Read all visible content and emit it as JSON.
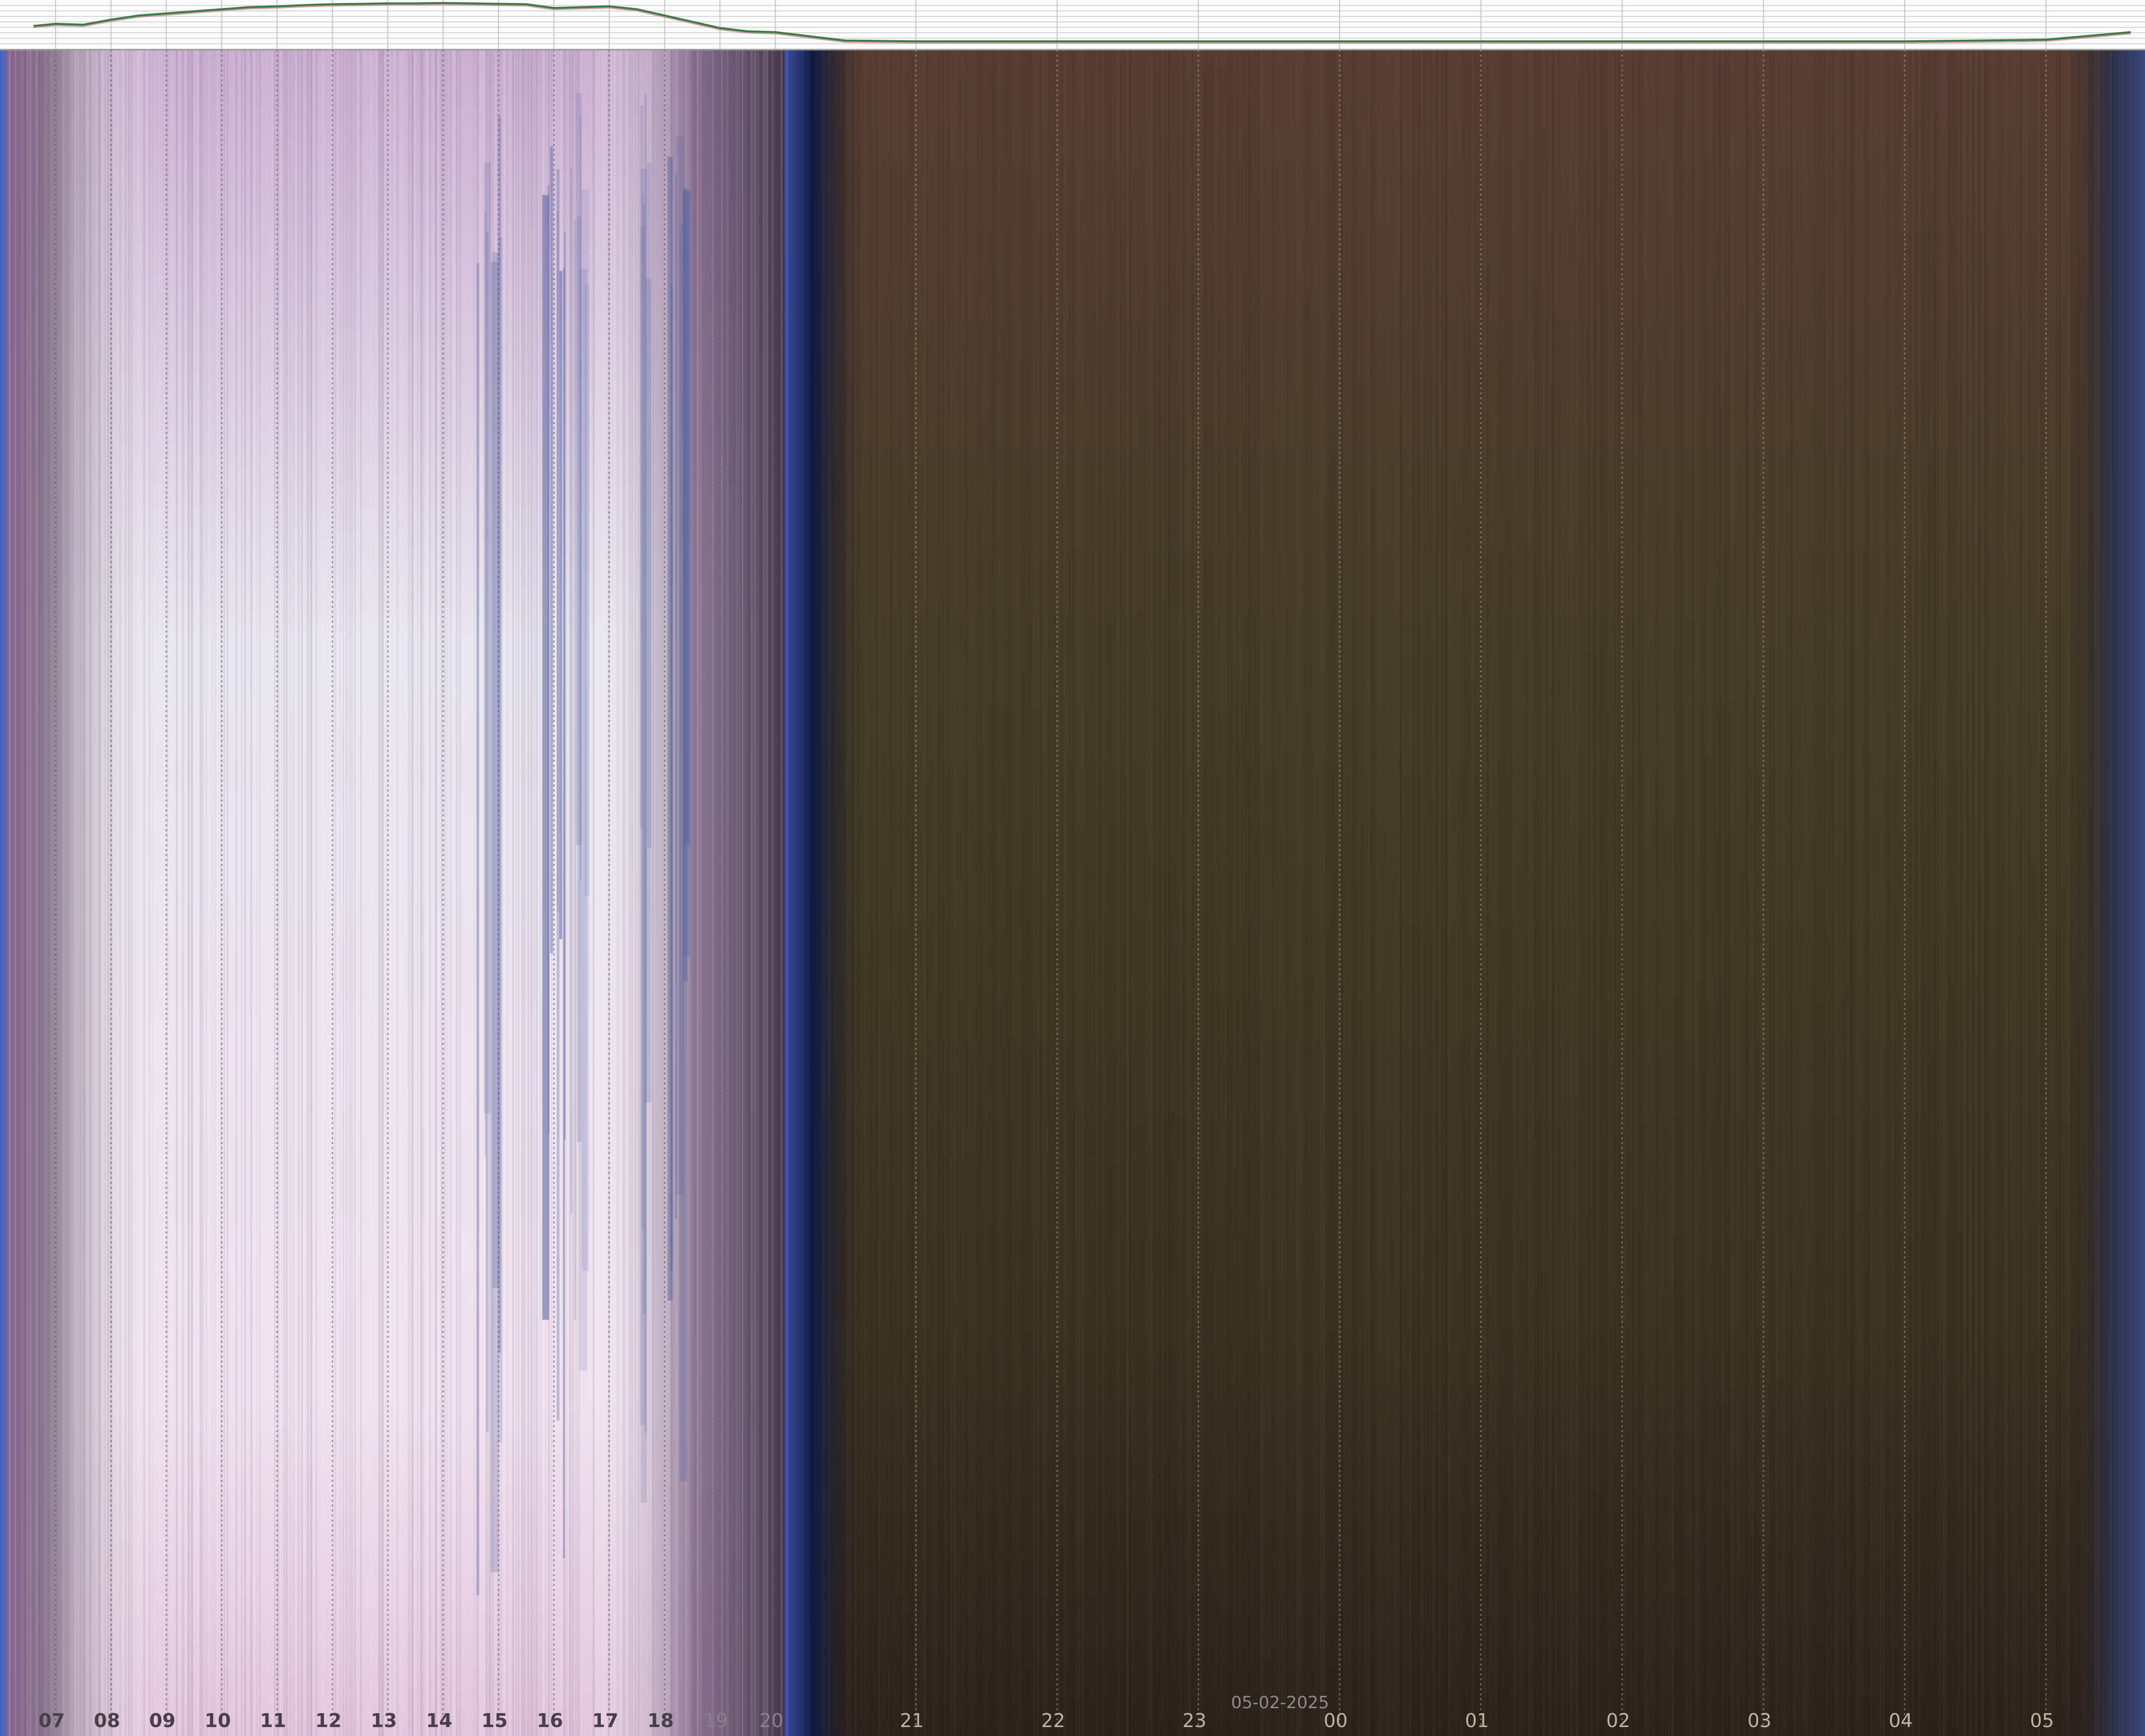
{
  "chart_data": {
    "type": "heatmap",
    "title": "",
    "xlabel": "",
    "ylabel": "",
    "date_label": "05-02-2025",
    "tick_labels": [
      "07",
      "08",
      "09",
      "10",
      "11",
      "12",
      "13",
      "14",
      "15",
      "16",
      "17",
      "18",
      "19",
      "20",
      "21",
      "22",
      "23",
      "00",
      "01",
      "02",
      "03",
      "04",
      "05"
    ],
    "keogram_colors": {
      "day_edge": "#8a6a8e",
      "day_mid": "#c8c0d2",
      "day_bright": "#f2eef6",
      "day_pink": "#e9d6e8",
      "cloud_blue": "#5a64a0",
      "dusk": "#4a4050",
      "twilight_blue": "#1c2e6a",
      "night_top": "#5a4036",
      "night_mid": "#443c26",
      "night_bottom": "#2e241e"
    },
    "brightness_series": {
      "x_hours": [
        6.6,
        7,
        7.5,
        8,
        8.5,
        9,
        9.5,
        10,
        10.5,
        11,
        11.5,
        12,
        12.5,
        13,
        13.5,
        14,
        14.5,
        15,
        15.5,
        16,
        16.5,
        17,
        17.5,
        18,
        18.5,
        19,
        19.5,
        20,
        20.5,
        21,
        22,
        23,
        24,
        25,
        26,
        27,
        28,
        29,
        29.6
      ],
      "values": [
        0.45,
        0.5,
        0.48,
        0.6,
        0.7,
        0.75,
        0.8,
        0.85,
        0.9,
        0.92,
        0.95,
        0.97,
        0.98,
        0.99,
        0.99,
        1.0,
        0.99,
        0.98,
        0.97,
        0.88,
        0.9,
        0.92,
        0.85,
        0.7,
        0.55,
        0.4,
        0.32,
        0.3,
        0.1,
        0.08,
        0.08,
        0.08,
        0.08,
        0.08,
        0.08,
        0.08,
        0.08,
        0.12,
        0.3
      ],
      "line_color": "#3d7a45"
    }
  }
}
